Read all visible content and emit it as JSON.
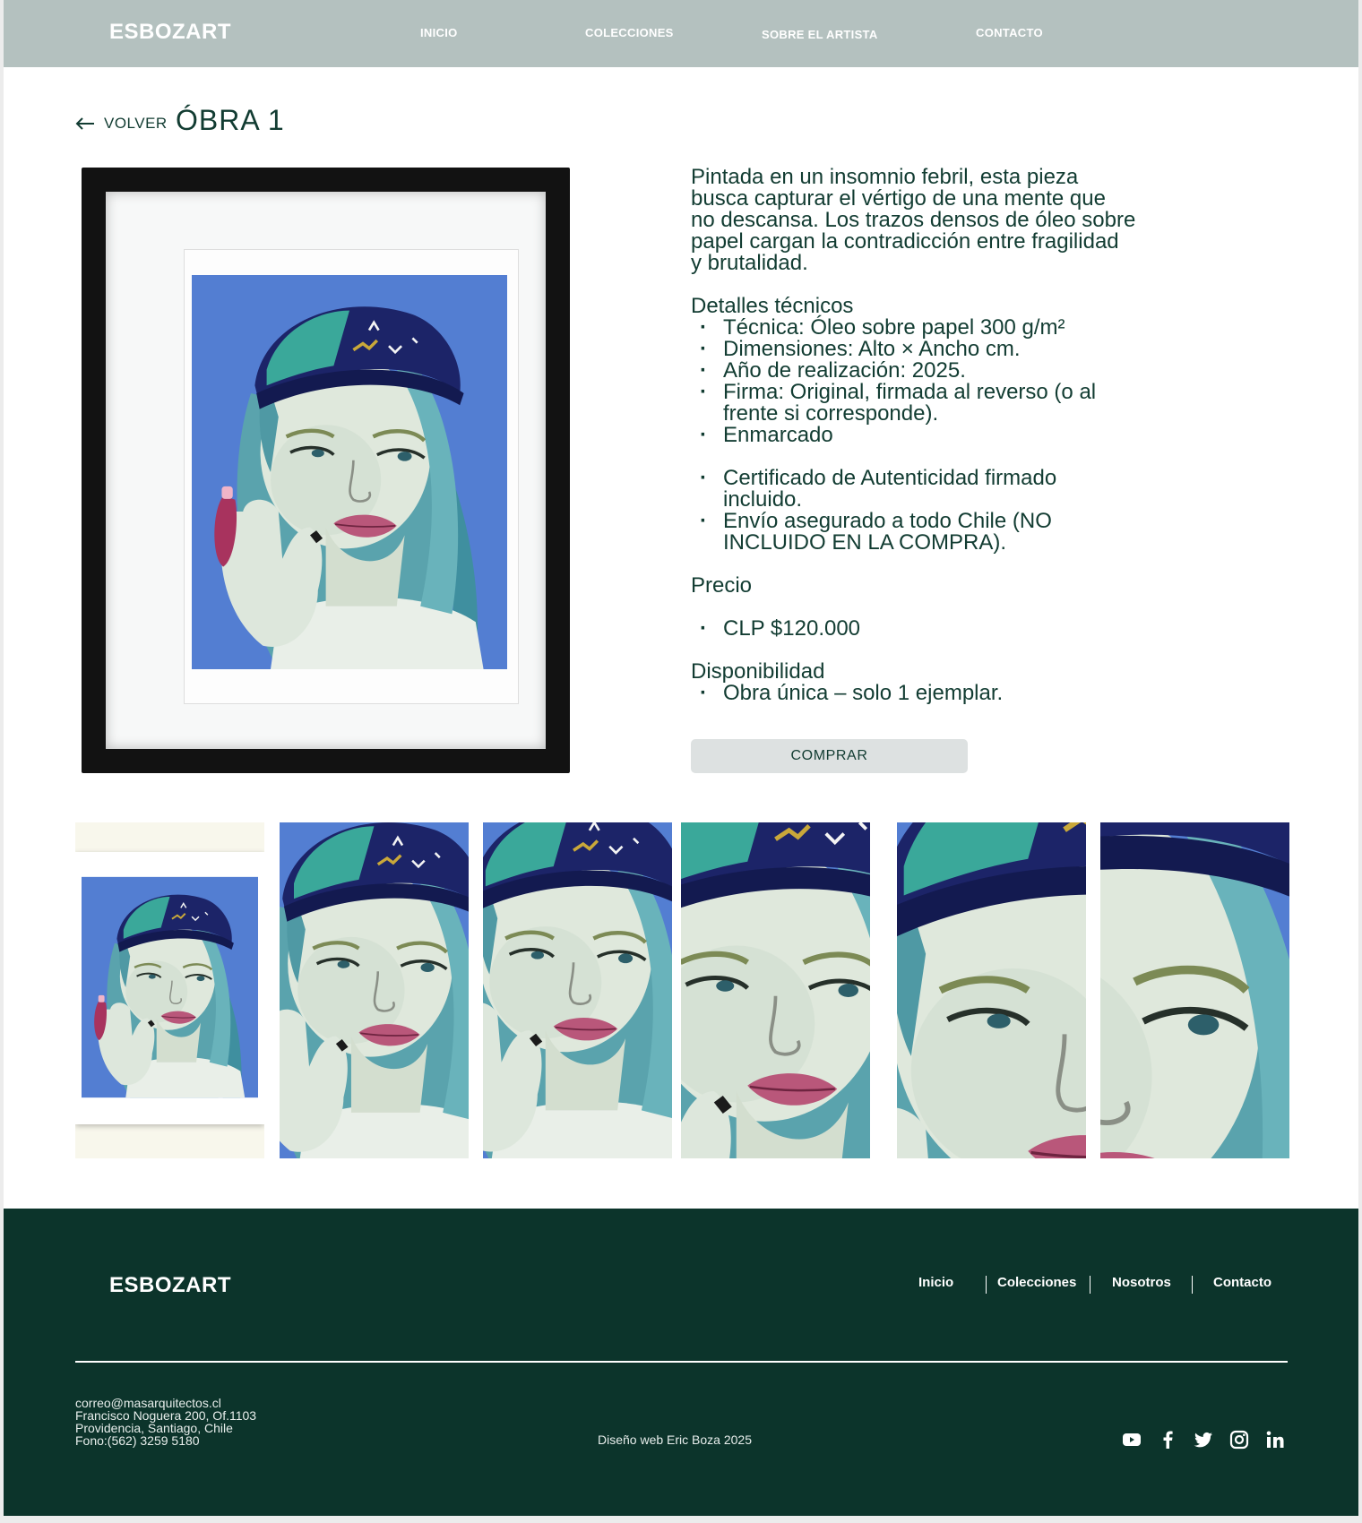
{
  "header": {
    "brand": "ESBOZART",
    "nav": [
      "INICIO",
      "COLECCIONES",
      "SOBRE EL ARTISTA",
      "CONTACTO"
    ]
  },
  "page": {
    "back_label": "VOLVER",
    "title": "ÓBRA 1"
  },
  "description": {
    "intro": [
      "Pintada en un insomnio febril, esta pieza",
      "busca capturar el vértigo de una mente que",
      "no descansa. Los trazos densos de óleo sobre",
      "papel cargan la contradicción entre fragilidad",
      "y brutalidad."
    ],
    "details_heading": "Detalles técnicos",
    "details": [
      [
        "Técnica: Óleo sobre papel 300 g/m²"
      ],
      [
        "Dimensiones: Alto × Ancho cm."
      ],
      [
        "Año de realización: 2025."
      ],
      [
        "Firma: Original, firmada al reverso (o al",
        "frente si corresponde)."
      ],
      [
        "Enmarcado"
      ]
    ],
    "extras": [
      [
        "Certificado de Autenticidad firmado",
        "incluido."
      ],
      [
        "Envío asegurado a todo Chile (NO",
        "INCLUIDO EN LA COMPRA)."
      ]
    ],
    "price_heading": "Precio",
    "price": "CLP $120.000",
    "availability_heading": "Disponibilidad",
    "availability": "Obra única – solo 1 ejemplar.",
    "buy_label": "COMPRAR"
  },
  "footer": {
    "brand": "ESBOZART",
    "nav": [
      "Inicio",
      "Colecciones",
      "Nosotros",
      "Contacto"
    ],
    "contact": [
      "correo@masarquitectos.cl",
      "Francisco Noguera 200, Of.1103",
      "Providencia, Santiago, Chile",
      "Fono:(562) 3259 5180"
    ],
    "credit": "Diseño web Eric Boza 2025",
    "social_icons": [
      "youtube-icon",
      "facebook-icon",
      "twitter-icon",
      "instagram-icon",
      "linkedin-icon"
    ]
  },
  "colors": {
    "header_bg": "#b4c1bf",
    "footer_bg": "#0c342b",
    "text": "#123c32",
    "button_bg": "#dde1e1",
    "painting_blue": "#4a78d0",
    "cap_navy": "#1c2468",
    "hair_teal": "#5aa6b0"
  }
}
